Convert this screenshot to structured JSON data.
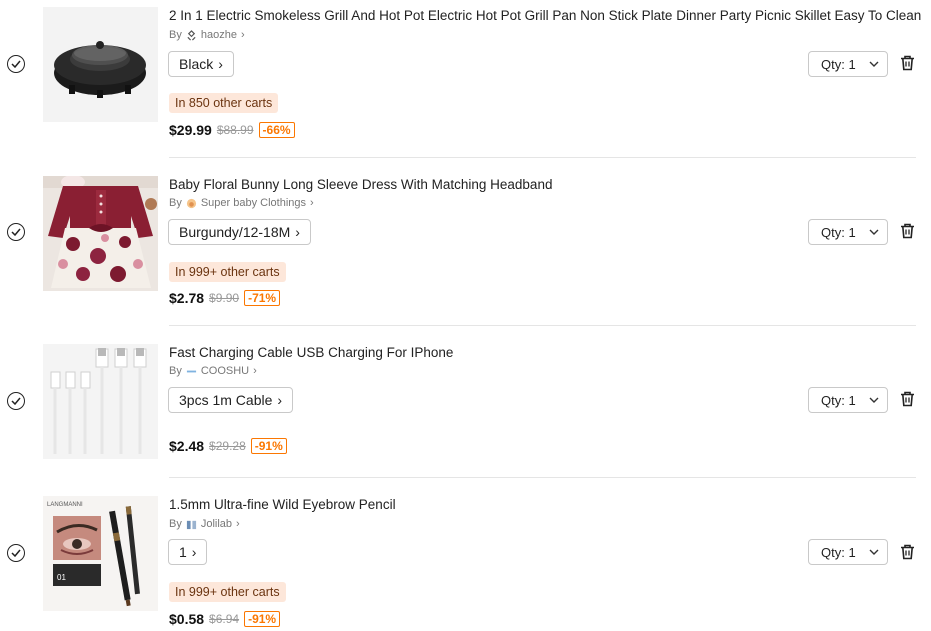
{
  "cart": {
    "items": [
      {
        "title": "2 In 1 Electric Smokeless Grill And Hot Pot Electric Hot Pot Grill Pan Non Stick Plate Dinner Party Picnic Skillet Easy To Clean",
        "by": "By",
        "seller": "haozhe",
        "variant": "Black",
        "carts_note": "In 850 other carts",
        "price": "$29.99",
        "original_price": "$88.99",
        "discount": "-66%",
        "qty_label": "Qty: 1",
        "image_icon": "grill-hotpot-image"
      },
      {
        "title": "Baby Floral Bunny Long Sleeve Dress With Matching Headband",
        "by": "By",
        "seller": "Super baby Clothings",
        "variant": "Burgundy/12-18M",
        "carts_note": "In 999+ other carts",
        "price": "$2.78",
        "original_price": "$9.90",
        "discount": "-71%",
        "qty_label": "Qty: 1",
        "image_icon": "baby-dress-image"
      },
      {
        "title": "Fast Charging Cable USB Charging For IPhone",
        "by": "By",
        "seller": "COOSHU",
        "variant": "3pcs 1m Cable",
        "price": "$2.48",
        "original_price": "$29.28",
        "discount": "-91%",
        "qty_label": "Qty: 1",
        "image_icon": "usb-cable-image"
      },
      {
        "title": "1.5mm Ultra-fine Wild Eyebrow Pencil",
        "by": "By",
        "seller": "Jolilab",
        "variant": "1",
        "carts_note": "In 999+ other carts",
        "price": "$0.58",
        "original_price": "$6.94",
        "discount": "-91%",
        "qty_label": "Qty: 1",
        "image_icon": "eyebrow-pencil-image",
        "image_brand_text": "LANGMANNI",
        "image_shade_text": "01"
      }
    ]
  },
  "colors": {
    "accent_orange": "#fb7701",
    "carts_badge_bg": "#fde7da",
    "text_primary": "#222222",
    "text_muted": "#777777"
  }
}
